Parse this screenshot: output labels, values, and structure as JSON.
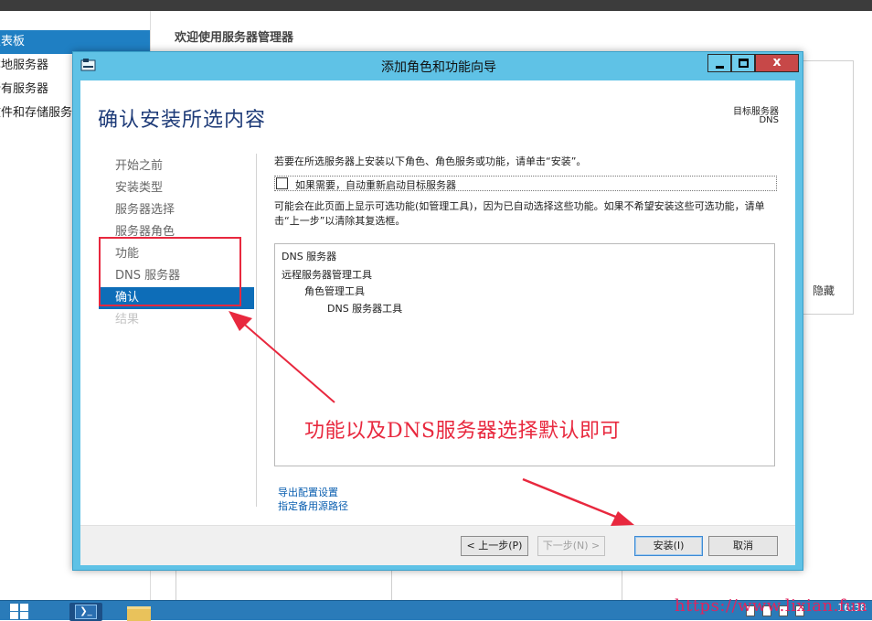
{
  "background": {
    "sidebar_items": [
      {
        "label": "仪表板",
        "active": true
      },
      {
        "label": "本地服务器",
        "active": false
      },
      {
        "label": "所有服务器",
        "active": false
      },
      {
        "label": "文件和存储服务",
        "active": false
      }
    ],
    "welcome_title": "欢迎使用服务器管理器",
    "panel_hide_label": "隐藏"
  },
  "dialog": {
    "title": "添加角色和功能向导",
    "window_buttons": {
      "minimize": "_",
      "maximize": "□",
      "close": "x"
    },
    "page_heading": "确认安装所选内容",
    "target_server_label": "目标服务器",
    "target_server_value": "DNS",
    "steps": [
      {
        "label": "开始之前",
        "state": "normal"
      },
      {
        "label": "安装类型",
        "state": "normal"
      },
      {
        "label": "服务器选择",
        "state": "normal"
      },
      {
        "label": "服务器角色",
        "state": "normal"
      },
      {
        "label": "功能",
        "state": "normal"
      },
      {
        "label": "DNS 服务器",
        "state": "normal"
      },
      {
        "label": "确认",
        "state": "active"
      },
      {
        "label": "结果",
        "state": "disabled"
      }
    ],
    "intro_text": "若要在所选服务器上安装以下角色、角色服务或功能，请单击“安装”。",
    "restart_checkbox": {
      "label": "如果需要，自动重新启动目标服务器",
      "checked": false
    },
    "note_text": "可能会在此页面上显示可选功能(如管理工具)，因为已自动选择这些功能。如果不希望安装这些可选功能，请单击“上一步”以清除其复选框。",
    "selection_list": [
      {
        "label": "DNS 服务器",
        "level": 0
      },
      {
        "label": "远程服务器管理工具",
        "level": 0
      },
      {
        "label": "角色管理工具",
        "level": 1
      },
      {
        "label": "DNS 服务器工具",
        "level": 2
      }
    ],
    "links": {
      "export": "导出配置设置",
      "alt_source": "指定备用源路径"
    },
    "buttons": {
      "previous": "< 上一步(P)",
      "next": "下一步(N) >",
      "install": "安装(I)",
      "cancel": "取消"
    }
  },
  "annotation": {
    "text": "功能以及DNS服务器选择默认即可",
    "color": "#e8283e"
  },
  "taskbar": {
    "clock": "16:38",
    "powershell_glyph": "❯_"
  },
  "watermark": "https://www.lixian.fun"
}
